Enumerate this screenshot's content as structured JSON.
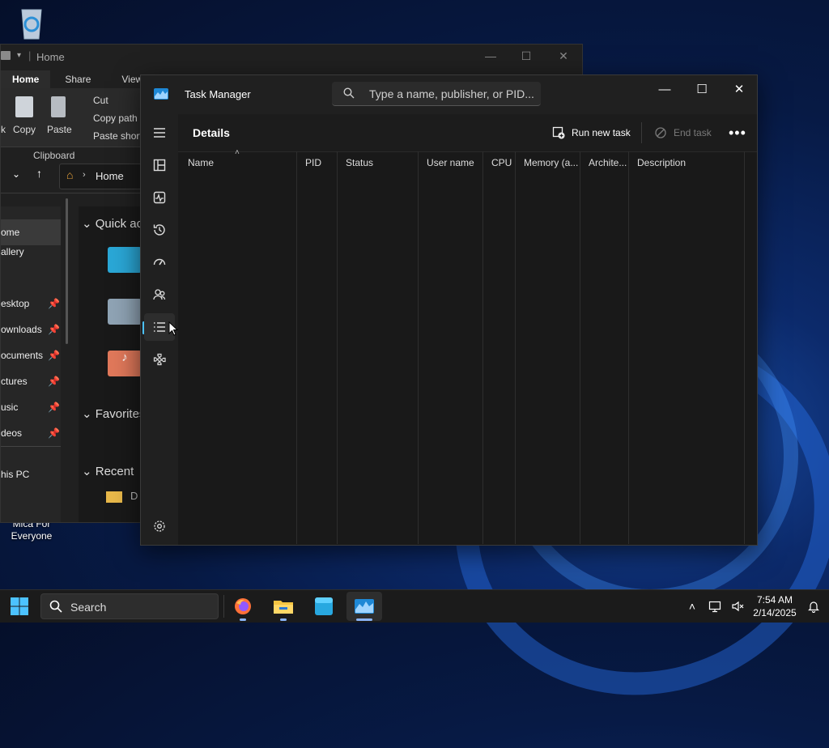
{
  "desktop": {
    "icons": [
      {
        "label": "Mica For Everyone"
      }
    ]
  },
  "explorer": {
    "title": "Home",
    "tabs": [
      "Home",
      "Share",
      "View"
    ],
    "ribbon": {
      "copy": "Copy",
      "paste": "Paste",
      "cut": "Cut",
      "copy_path": "Copy path",
      "paste_shortcut": "Paste short",
      "group": "Clipboard",
      "partial_left": "k"
    },
    "address": "Home",
    "nav_items": [
      "ome",
      "allery",
      "esktop",
      "ownloads",
      "ocuments",
      "ctures",
      "usic",
      "deos",
      "his PC"
    ],
    "sections": [
      "Quick ac",
      "Favorites",
      "Recent"
    ],
    "recent_item": "D"
  },
  "task_manager": {
    "title": "Task Manager",
    "search_placeholder": "Type a name, publisher, or PID...",
    "page_title": "Details",
    "run_new_task": "Run new task",
    "end_task": "End task",
    "columns": [
      "Name",
      "PID",
      "Status",
      "User name",
      "CPU",
      "Memory (a...",
      "Archite...",
      "Description"
    ],
    "sidebar": [
      "menu-icon",
      "processes-icon",
      "performance-icon",
      "app-history-icon",
      "startup-icon",
      "users-icon",
      "details-icon",
      "services-icon",
      "settings-icon"
    ],
    "accent": "#4cc2ff"
  },
  "taskbar": {
    "search_label": "Search",
    "time": "7:54 AM",
    "date": "2/14/2025"
  }
}
